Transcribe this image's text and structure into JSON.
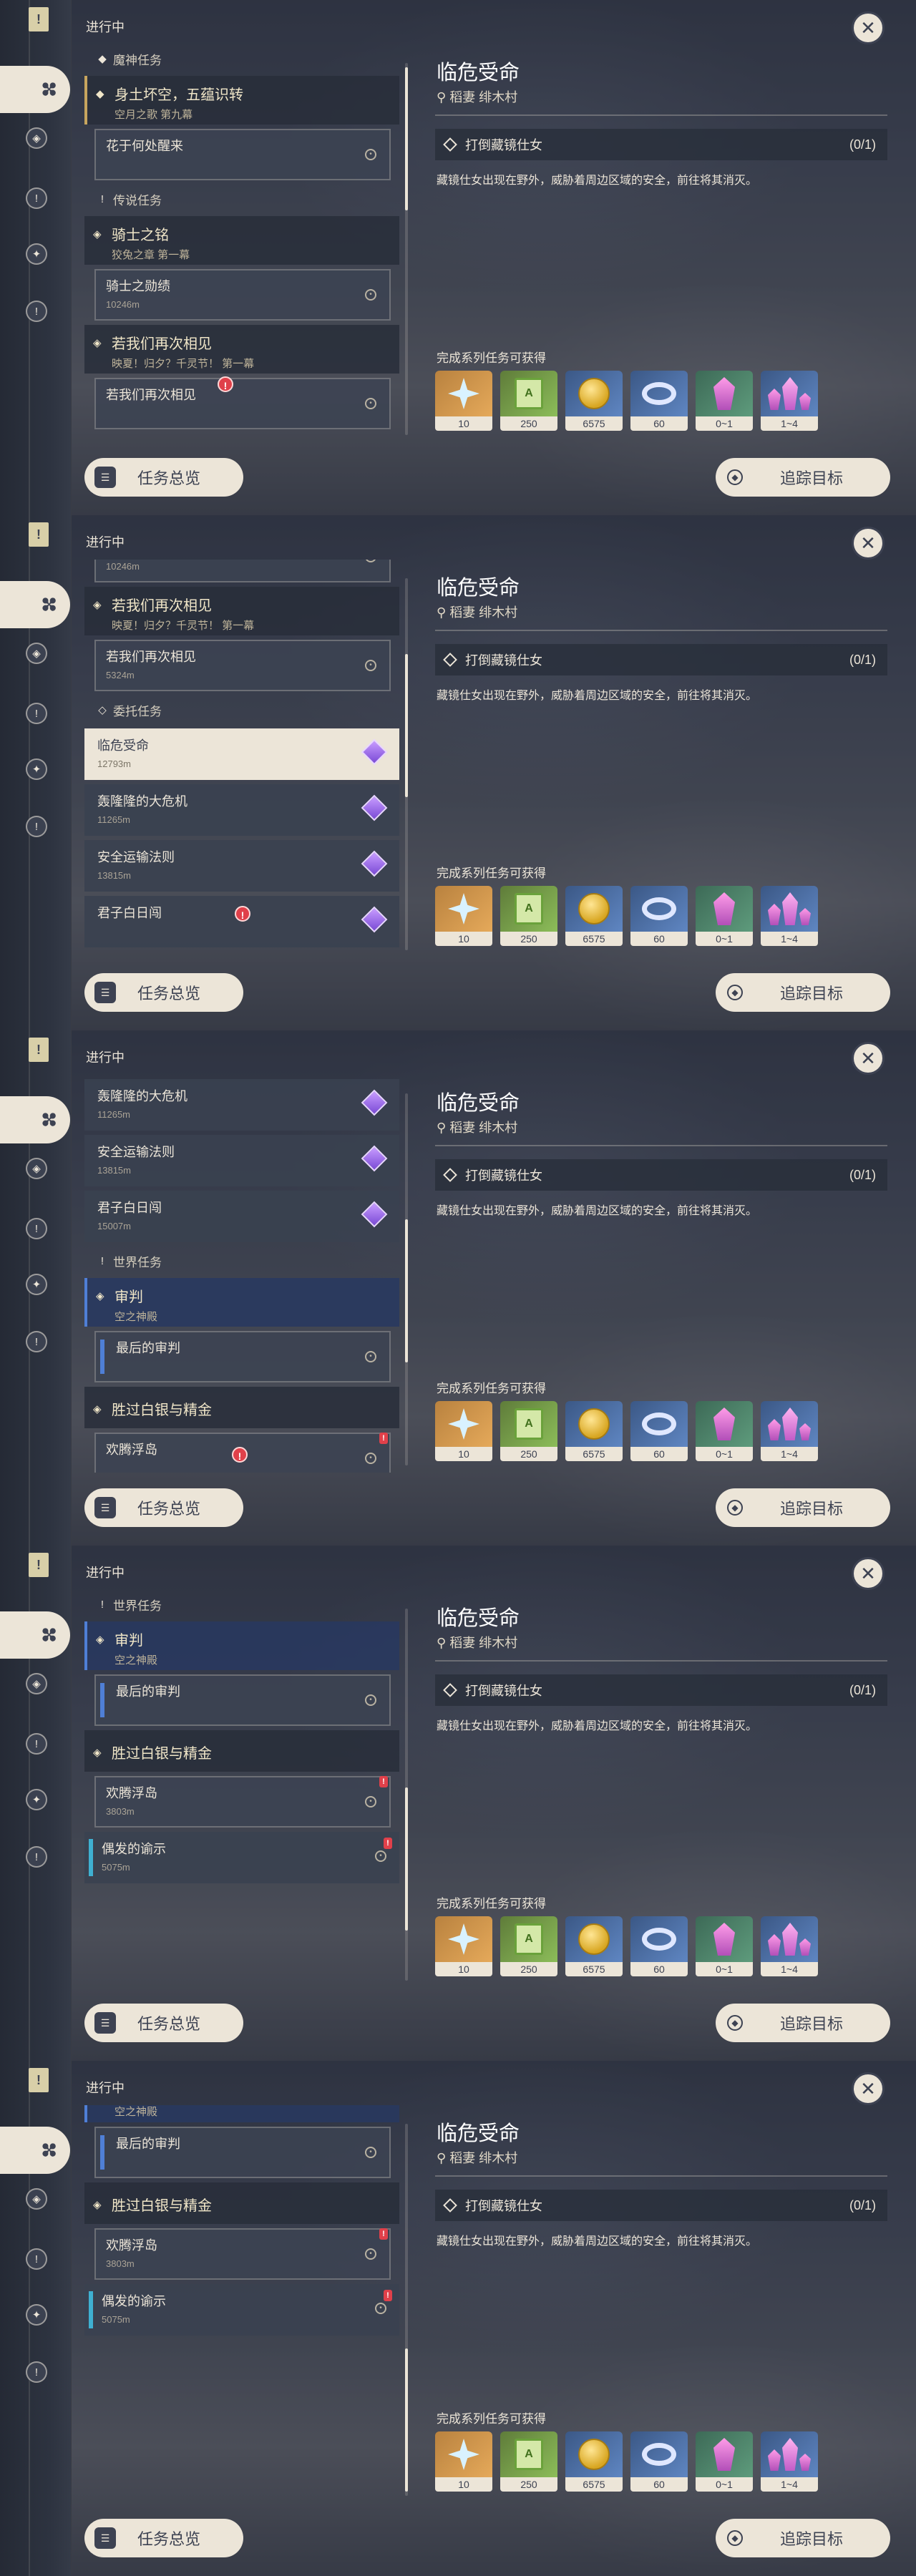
{
  "panels": [
    {
      "list_title": "进行中",
      "quest_items": [
        {
          "kind": "section",
          "icon": "archon-quest-icon",
          "label": "魔神任务"
        },
        {
          "kind": "group",
          "style": "gold",
          "icon": "archon-quest-icon",
          "title": "身土坏空，五蕴识转",
          "subtitle": "空月之歌 第九幕"
        },
        {
          "kind": "sub",
          "title": "花于何处醒来",
          "distance": ""
        },
        {
          "kind": "section",
          "icon": "exclaim-icon",
          "label": "传说任务"
        },
        {
          "kind": "group",
          "style": "",
          "icon": "legend-quest-icon",
          "title": "骑士之铭",
          "subtitle": "狡兔之章 第一幕"
        },
        {
          "kind": "sub",
          "title": "骑士之勋绩",
          "distance": "10246m"
        },
        {
          "kind": "group",
          "style": "",
          "icon": "legend-quest-icon",
          "title": "若我们再次相见",
          "subtitle": "映夏！归夕？千灵节！ 第一幕"
        },
        {
          "kind": "sub",
          "title": "若我们再次相见",
          "distance": "",
          "alert": true
        }
      ],
      "scroll_pos": 0.02
    },
    {
      "list_title": "进行中",
      "quest_items": [
        {
          "kind": "sub",
          "title": "骑士之勋绩",
          "distance": "10246m",
          "offset": true
        },
        {
          "kind": "group",
          "style": "",
          "icon": "legend-quest-icon",
          "title": "若我们再次相见",
          "subtitle": "映夏！归夕？千灵节！ 第一幕"
        },
        {
          "kind": "sub",
          "title": "若我们再次相见",
          "distance": "5324m"
        },
        {
          "kind": "section",
          "icon": "commission-icon",
          "label": "委托任务"
        },
        {
          "kind": "comm",
          "title": "临危受命",
          "distance": "12793m",
          "selected": true
        },
        {
          "kind": "comm",
          "title": "轰隆隆的大危机",
          "distance": "11265m"
        },
        {
          "kind": "comm",
          "title": "安全运输法则",
          "distance": "13815m"
        },
        {
          "kind": "comm",
          "title": "君子白日闯",
          "distance": "",
          "alert": true
        }
      ],
      "scroll_pos": 0.33
    },
    {
      "list_title": "进行中",
      "quest_items": [
        {
          "kind": "comm",
          "title": "轰隆隆的大危机",
          "distance": "11265m"
        },
        {
          "kind": "comm",
          "title": "安全运输法则",
          "distance": "13815m"
        },
        {
          "kind": "comm",
          "title": "君子白日闯",
          "distance": "15007m"
        },
        {
          "kind": "section",
          "icon": "exclaim-icon",
          "label": "世界任务"
        },
        {
          "kind": "group",
          "style": "hl",
          "icon": "world-quest-icon",
          "title": "审判",
          "subtitle": "空之神殿"
        },
        {
          "kind": "sub",
          "title": "最后的审判",
          "distance": "",
          "bar": true
        },
        {
          "kind": "group",
          "style": "simple",
          "icon": "world-quest-icon",
          "title": "胜过白银与精金",
          "subtitle": ""
        },
        {
          "kind": "sub",
          "title": "欢腾浮岛",
          "distance": "",
          "alert": true,
          "alert_small": true
        }
      ],
      "scroll_pos": 0.55
    },
    {
      "list_title": "进行中",
      "quest_items": [
        {
          "kind": "section",
          "icon": "exclaim-icon",
          "label": "世界任务"
        },
        {
          "kind": "group",
          "style": "hl",
          "icon": "world-quest-icon",
          "title": "审判",
          "subtitle": "空之神殿"
        },
        {
          "kind": "sub",
          "title": "最后的审判",
          "distance": "",
          "bar": true
        },
        {
          "kind": "group",
          "style": "simple",
          "icon": "world-quest-icon",
          "title": "胜过白银与精金",
          "subtitle": ""
        },
        {
          "kind": "sub",
          "title": "欢腾浮岛",
          "distance": "3803m",
          "alert_small": true
        },
        {
          "kind": "comm",
          "title": "偶发的谕示",
          "distance": "5075m",
          "tag": true,
          "alert_small": true
        }
      ],
      "scroll_pos": 0.78
    },
    {
      "list_title": "进行中",
      "quest_items": [
        {
          "kind": "partial",
          "text": "空之神殿"
        },
        {
          "kind": "sub",
          "title": "最后的审判",
          "distance": "",
          "bar": true
        },
        {
          "kind": "group",
          "style": "simple",
          "icon": "world-quest-icon",
          "title": "胜过白银与精金",
          "subtitle": ""
        },
        {
          "kind": "sub",
          "title": "欢腾浮岛",
          "distance": "3803m",
          "alert_small": true
        },
        {
          "kind": "comm",
          "title": "偶发的谕示",
          "distance": "5075m",
          "tag": true,
          "alert_small": true
        }
      ],
      "scroll_pos": 0.98
    }
  ],
  "detail": {
    "title": "临危受命",
    "location": "稻妻 绯木村",
    "objective": "打倒藏镜仕女",
    "objective_count": "(0/1)",
    "description": "藏镜仕女出现在野外，威胁着周边区域的安全，前往将其消灭。",
    "rewards_label": "完成系列任务可获得",
    "rewards": [
      {
        "icon": "primogem-icon",
        "rarity": "r5",
        "count": "10"
      },
      {
        "icon": "adventure-exp-icon",
        "rarity": "r4",
        "count": "250"
      },
      {
        "icon": "mora-icon",
        "rarity": "r3",
        "count": "6575"
      },
      {
        "icon": "companionship-exp-icon",
        "rarity": "r3",
        "count": "60"
      },
      {
        "icon": "crystal-chunk-icon",
        "rarity": "r2",
        "count": "0~1"
      },
      {
        "icon": "crystal-cluster-icon",
        "rarity": "r3",
        "count": "1~4"
      }
    ]
  },
  "buttons": {
    "overview": "任务总览",
    "track": "追踪目标"
  },
  "sidebar_icons": [
    "quest-book-icon",
    "quest-category-icon",
    "archon-quest-icon",
    "exclaim-icon",
    "world-quest-icon",
    "commission-icon"
  ]
}
